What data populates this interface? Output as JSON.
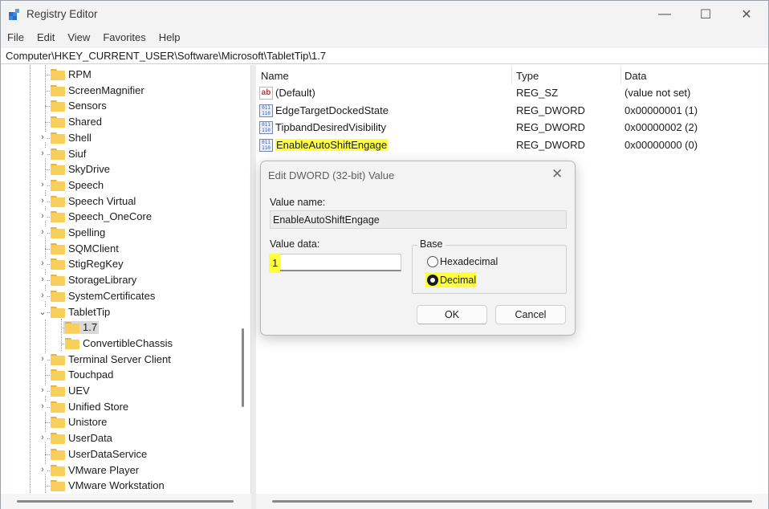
{
  "window": {
    "title": "Registry Editor",
    "controls": {
      "minimize": "—",
      "maximize": "☐",
      "close": "✕"
    }
  },
  "menu": [
    "File",
    "Edit",
    "View",
    "Favorites",
    "Help"
  ],
  "address": "Computer\\HKEY_CURRENT_USER\\Software\\Microsoft\\TabletTip\\1.7",
  "tree": {
    "items": [
      {
        "label": "RPM",
        "expander": ""
      },
      {
        "label": "ScreenMagnifier",
        "expander": ""
      },
      {
        "label": "Sensors",
        "expander": ""
      },
      {
        "label": "Shared",
        "expander": ""
      },
      {
        "label": "Shell",
        "expander": "›"
      },
      {
        "label": "Siuf",
        "expander": "›"
      },
      {
        "label": "SkyDrive",
        "expander": ""
      },
      {
        "label": "Speech",
        "expander": "›"
      },
      {
        "label": "Speech Virtual",
        "expander": "›"
      },
      {
        "label": "Speech_OneCore",
        "expander": "›"
      },
      {
        "label": "Spelling",
        "expander": "›"
      },
      {
        "label": "SQMClient",
        "expander": ""
      },
      {
        "label": "StigRegKey",
        "expander": "›"
      },
      {
        "label": "StorageLibrary",
        "expander": "›"
      },
      {
        "label": "SystemCertificates",
        "expander": "›"
      },
      {
        "label": "TabletTip",
        "expander": "⌄"
      },
      {
        "label": "1.7",
        "expander": ""
      },
      {
        "label": "ConvertibleChassis",
        "expander": ""
      },
      {
        "label": "Terminal Server Client",
        "expander": "›"
      },
      {
        "label": "Touchpad",
        "expander": ""
      },
      {
        "label": "UEV",
        "expander": "›"
      },
      {
        "label": "Unified Store",
        "expander": "›"
      },
      {
        "label": "Unistore",
        "expander": ""
      },
      {
        "label": "UserData",
        "expander": "›"
      },
      {
        "label": "UserDataService",
        "expander": ""
      },
      {
        "label": "VMware Player",
        "expander": "›"
      },
      {
        "label": "VMware Workstation",
        "expander": ""
      }
    ]
  },
  "values": {
    "columns": {
      "name": "Name",
      "type": "Type",
      "data": "Data"
    },
    "rows": [
      {
        "name": "(Default)",
        "type": "REG_SZ",
        "data": "(value not set)",
        "icon": "ab"
      },
      {
        "name": "EdgeTargetDockedState",
        "type": "REG_DWORD",
        "data": "0x00000001 (1)",
        "icon": "binary"
      },
      {
        "name": "TipbandDesiredVisibility",
        "type": "REG_DWORD",
        "data": "0x00000002 (2)",
        "icon": "binary"
      },
      {
        "name": "EnableAutoShiftEngage",
        "type": "REG_DWORD",
        "data": "0x00000000 (0)",
        "icon": "binary"
      }
    ]
  },
  "dialog": {
    "title": "Edit DWORD (32-bit) Value",
    "close": "✕",
    "value_name_label": "Value name:",
    "value_name": "EnableAutoShiftEngage",
    "value_data_label": "Value data:",
    "value_data": "1",
    "base_label": "Base",
    "hex_label": "Hexadecimal",
    "dec_label": "Decimal",
    "ok": "OK",
    "cancel": "Cancel"
  },
  "colors": {
    "highlight": "#ffff3c",
    "folder": "#f7cf5a",
    "selection": "#d9d9d9"
  }
}
